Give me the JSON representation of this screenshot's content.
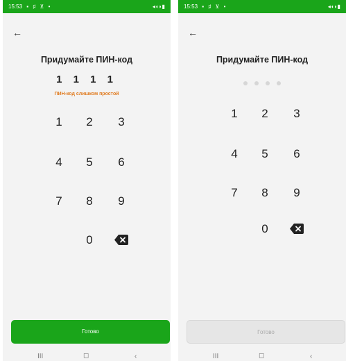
{
  "colors": {
    "accent": "#1aa51a",
    "error": "#e07a1e",
    "screen_bg": "#f3f3f3",
    "disabled_bg": "#e6e6e6"
  },
  "status_bar": {
    "time": "15:53",
    "left_icons": "▪ ♯ ⊻ •",
    "right_icons": "◂◖◗▮"
  },
  "screens": {
    "left": {
      "title": "Придумайте ПИН-код",
      "pin_value": "1 1 1 1",
      "error": "ПИН-код слишком простой",
      "done_label": "Готово",
      "done_enabled": true
    },
    "right": {
      "title": "Придумайте ПИН-код",
      "pin_filled": 0,
      "pin_length": 4,
      "done_label": "Готово",
      "done_enabled": false
    }
  },
  "keypad": {
    "keys": [
      "1",
      "2",
      "3",
      "4",
      "5",
      "6",
      "7",
      "8",
      "9",
      "0"
    ],
    "backspace_icon": "backspace-icon"
  },
  "nav_bar": {
    "recent_glyph": "III",
    "home_glyph": "◻",
    "back_glyph": "‹"
  },
  "icons": [
    "back-arrow-icon",
    "backspace-icon",
    "status-icons"
  ]
}
